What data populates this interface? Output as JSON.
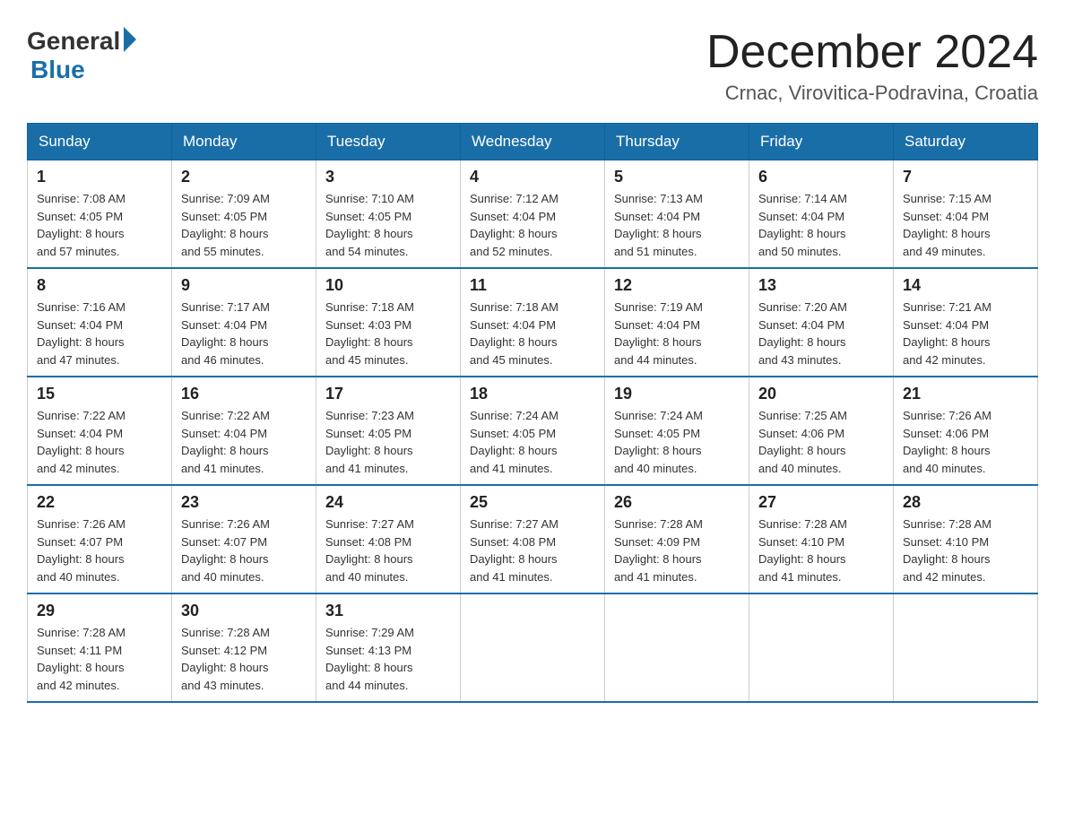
{
  "header": {
    "logo_general": "General",
    "logo_blue": "Blue",
    "month_title": "December 2024",
    "location": "Crnac, Virovitica-Podravina, Croatia"
  },
  "days_of_week": [
    "Sunday",
    "Monday",
    "Tuesday",
    "Wednesday",
    "Thursday",
    "Friday",
    "Saturday"
  ],
  "weeks": [
    [
      {
        "day": "1",
        "sunrise": "7:08 AM",
        "sunset": "4:05 PM",
        "daylight": "8 hours and 57 minutes."
      },
      {
        "day": "2",
        "sunrise": "7:09 AM",
        "sunset": "4:05 PM",
        "daylight": "8 hours and 55 minutes."
      },
      {
        "day": "3",
        "sunrise": "7:10 AM",
        "sunset": "4:05 PM",
        "daylight": "8 hours and 54 minutes."
      },
      {
        "day": "4",
        "sunrise": "7:12 AM",
        "sunset": "4:04 PM",
        "daylight": "8 hours and 52 minutes."
      },
      {
        "day": "5",
        "sunrise": "7:13 AM",
        "sunset": "4:04 PM",
        "daylight": "8 hours and 51 minutes."
      },
      {
        "day": "6",
        "sunrise": "7:14 AM",
        "sunset": "4:04 PM",
        "daylight": "8 hours and 50 minutes."
      },
      {
        "day": "7",
        "sunrise": "7:15 AM",
        "sunset": "4:04 PM",
        "daylight": "8 hours and 49 minutes."
      }
    ],
    [
      {
        "day": "8",
        "sunrise": "7:16 AM",
        "sunset": "4:04 PM",
        "daylight": "8 hours and 47 minutes."
      },
      {
        "day": "9",
        "sunrise": "7:17 AM",
        "sunset": "4:04 PM",
        "daylight": "8 hours and 46 minutes."
      },
      {
        "day": "10",
        "sunrise": "7:18 AM",
        "sunset": "4:03 PM",
        "daylight": "8 hours and 45 minutes."
      },
      {
        "day": "11",
        "sunrise": "7:18 AM",
        "sunset": "4:04 PM",
        "daylight": "8 hours and 45 minutes."
      },
      {
        "day": "12",
        "sunrise": "7:19 AM",
        "sunset": "4:04 PM",
        "daylight": "8 hours and 44 minutes."
      },
      {
        "day": "13",
        "sunrise": "7:20 AM",
        "sunset": "4:04 PM",
        "daylight": "8 hours and 43 minutes."
      },
      {
        "day": "14",
        "sunrise": "7:21 AM",
        "sunset": "4:04 PM",
        "daylight": "8 hours and 42 minutes."
      }
    ],
    [
      {
        "day": "15",
        "sunrise": "7:22 AM",
        "sunset": "4:04 PM",
        "daylight": "8 hours and 42 minutes."
      },
      {
        "day": "16",
        "sunrise": "7:22 AM",
        "sunset": "4:04 PM",
        "daylight": "8 hours and 41 minutes."
      },
      {
        "day": "17",
        "sunrise": "7:23 AM",
        "sunset": "4:05 PM",
        "daylight": "8 hours and 41 minutes."
      },
      {
        "day": "18",
        "sunrise": "7:24 AM",
        "sunset": "4:05 PM",
        "daylight": "8 hours and 41 minutes."
      },
      {
        "day": "19",
        "sunrise": "7:24 AM",
        "sunset": "4:05 PM",
        "daylight": "8 hours and 40 minutes."
      },
      {
        "day": "20",
        "sunrise": "7:25 AM",
        "sunset": "4:06 PM",
        "daylight": "8 hours and 40 minutes."
      },
      {
        "day": "21",
        "sunrise": "7:26 AM",
        "sunset": "4:06 PM",
        "daylight": "8 hours and 40 minutes."
      }
    ],
    [
      {
        "day": "22",
        "sunrise": "7:26 AM",
        "sunset": "4:07 PM",
        "daylight": "8 hours and 40 minutes."
      },
      {
        "day": "23",
        "sunrise": "7:26 AM",
        "sunset": "4:07 PM",
        "daylight": "8 hours and 40 minutes."
      },
      {
        "day": "24",
        "sunrise": "7:27 AM",
        "sunset": "4:08 PM",
        "daylight": "8 hours and 40 minutes."
      },
      {
        "day": "25",
        "sunrise": "7:27 AM",
        "sunset": "4:08 PM",
        "daylight": "8 hours and 41 minutes."
      },
      {
        "day": "26",
        "sunrise": "7:28 AM",
        "sunset": "4:09 PM",
        "daylight": "8 hours and 41 minutes."
      },
      {
        "day": "27",
        "sunrise": "7:28 AM",
        "sunset": "4:10 PM",
        "daylight": "8 hours and 41 minutes."
      },
      {
        "day": "28",
        "sunrise": "7:28 AM",
        "sunset": "4:10 PM",
        "daylight": "8 hours and 42 minutes."
      }
    ],
    [
      {
        "day": "29",
        "sunrise": "7:28 AM",
        "sunset": "4:11 PM",
        "daylight": "8 hours and 42 minutes."
      },
      {
        "day": "30",
        "sunrise": "7:28 AM",
        "sunset": "4:12 PM",
        "daylight": "8 hours and 43 minutes."
      },
      {
        "day": "31",
        "sunrise": "7:29 AM",
        "sunset": "4:13 PM",
        "daylight": "8 hours and 44 minutes."
      },
      null,
      null,
      null,
      null
    ]
  ],
  "labels": {
    "sunrise": "Sunrise:",
    "sunset": "Sunset:",
    "daylight": "Daylight:"
  }
}
